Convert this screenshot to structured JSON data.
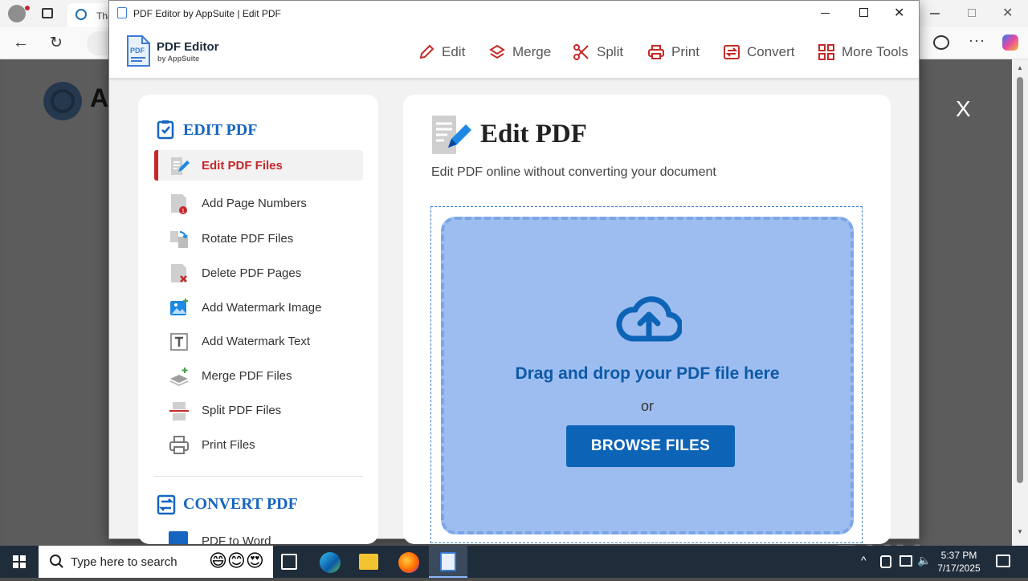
{
  "browser": {
    "tab_title": "Tha",
    "close_overlay": "X",
    "watermark": "ANY RUN"
  },
  "window": {
    "title": "PDF Editor by AppSuite | Edit PDF"
  },
  "app": {
    "logo_title": "PDF Editor",
    "logo_sub": "by AppSuite",
    "nav": [
      {
        "label": "Edit",
        "icon": "pencil-icon"
      },
      {
        "label": "Merge",
        "icon": "layers-icon"
      },
      {
        "label": "Split",
        "icon": "scissors-icon"
      },
      {
        "label": "Print",
        "icon": "printer-icon"
      },
      {
        "label": "Convert",
        "icon": "convert-icon"
      },
      {
        "label": "More Tools",
        "icon": "grid-icon"
      }
    ],
    "accent": "#c62828",
    "primary": "#0d64b7"
  },
  "sidebar": {
    "edit_heading": "EDIT PDF",
    "items": [
      {
        "label": "Edit PDF Files",
        "icon": "edit-file-icon",
        "active": true
      },
      {
        "label": "Add Page Numbers",
        "icon": "page-number-icon"
      },
      {
        "label": "Rotate PDF Files",
        "icon": "rotate-icon"
      },
      {
        "label": "Delete PDF Pages",
        "icon": "delete-page-icon"
      },
      {
        "label": "Add Watermark Image",
        "icon": "image-icon"
      },
      {
        "label": "Add Watermark Text",
        "icon": "text-icon"
      },
      {
        "label": "Merge PDF Files",
        "icon": "merge-icon"
      },
      {
        "label": "Split PDF Files",
        "icon": "split-icon"
      },
      {
        "label": "Print Files",
        "icon": "printer-icon"
      }
    ],
    "convert_heading": "CONVERT PDF",
    "partial_item": "PDF to Word"
  },
  "main": {
    "title": "Edit PDF",
    "subtitle": "Edit PDF online without converting your document",
    "drop_text": "Drag and drop your PDF file here",
    "or_text": "or",
    "browse_label": "BROWSE FILES"
  },
  "taskbar": {
    "search_placeholder": "Type here to search",
    "time": "5:37 PM",
    "date": "7/17/2025"
  }
}
